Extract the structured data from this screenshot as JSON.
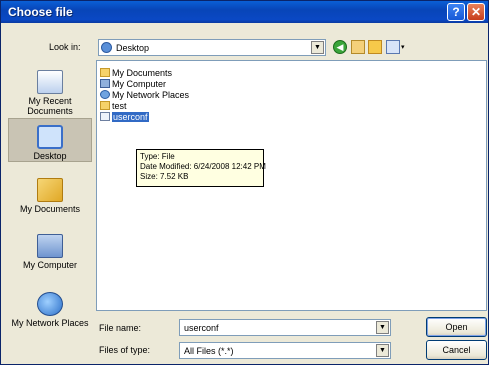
{
  "window": {
    "title": "Choose file",
    "help_glyph": "?",
    "close_glyph": "✕"
  },
  "lookin": {
    "label": "Look in:",
    "value": "Desktop",
    "arrow": "▼"
  },
  "toolbar": {
    "back_glyph": "◀",
    "views_arrow": "▾"
  },
  "places": [
    {
      "label": "My Recent Documents"
    },
    {
      "label": "Desktop"
    },
    {
      "label": "My Documents"
    },
    {
      "label": "My Computer"
    },
    {
      "label": "My Network Places"
    }
  ],
  "files": [
    {
      "name": "My Documents",
      "icon": "folder-icon"
    },
    {
      "name": "My Computer",
      "icon": "computer-icon"
    },
    {
      "name": "My Network Places",
      "icon": "network-icon"
    },
    {
      "name": "test",
      "icon": "folder-icon"
    },
    {
      "name": "userconf",
      "icon": "file-icon",
      "selected": true
    }
  ],
  "tooltip": {
    "type": "Type: File",
    "modified": "Date Modified: 6/24/2008 12:42 PM",
    "size": "Size: 7.52 KB"
  },
  "filename": {
    "label": "File name:",
    "value": "userconf"
  },
  "filetype": {
    "label": "Files of type:",
    "value": "All Files (*.*)"
  },
  "buttons": {
    "open": "Open",
    "cancel": "Cancel"
  }
}
